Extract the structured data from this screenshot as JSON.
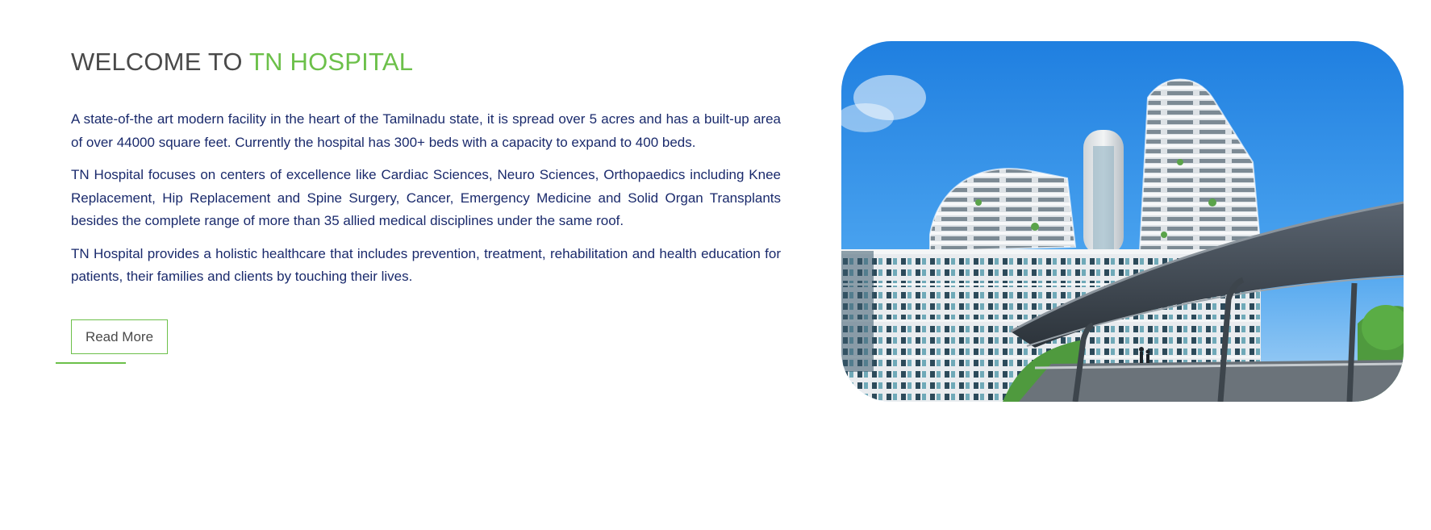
{
  "welcome": {
    "heading_prefix": "WELCOME TO ",
    "heading_accent": "TN HOSPITAL",
    "paragraphs": [
      "A state-of-the art modern facility in the heart of the Tamilnadu state, it is spread over 5 acres and has a built-up area of over 44000 square feet. Currently the hospital has 300+ beds with a capacity to expand to 400 beds.",
      "TN Hospital focuses on centers of excellence like Cardiac Sciences, Neuro Sciences, Orthopaedics including Knee Replacement, Hip Replacement and Spine Surgery, Cancer, Emergency Medicine and Solid Organ Transplants besides the complete range of more than 35 allied medical disciplines under the same roof.",
      "TN Hospital provides a holistic healthcare that includes prevention, treatment, rehabilitation and health education for patients, their families and clients by touching their lives."
    ],
    "read_more_label": "Read More"
  },
  "colors": {
    "accent": "#6cc04a",
    "heading": "#4a4a4a",
    "body_text": "#1a2a6c"
  },
  "image": {
    "subject": "hospital-building-photo"
  }
}
